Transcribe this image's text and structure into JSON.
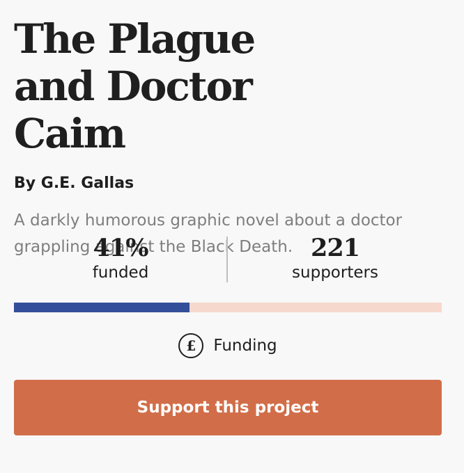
{
  "project": {
    "title": "The Plague and Doctor Caim",
    "author": "By G.E. Gallas",
    "description": "A darkly humorous graphic novel about a doctor grappling against the Black Death."
  },
  "stats": {
    "funded_value": "41%",
    "funded_label": "funded",
    "supporters_value": "221",
    "supporters_label": "supporters"
  },
  "progress": {
    "percent": 41,
    "fill_color": "#344f9a",
    "track_color": "#f6d8cc"
  },
  "status": {
    "icon": "pound-icon",
    "icon_glyph": "£",
    "label": "Funding"
  },
  "cta": {
    "label": "Support this project",
    "color": "#d16e49"
  }
}
